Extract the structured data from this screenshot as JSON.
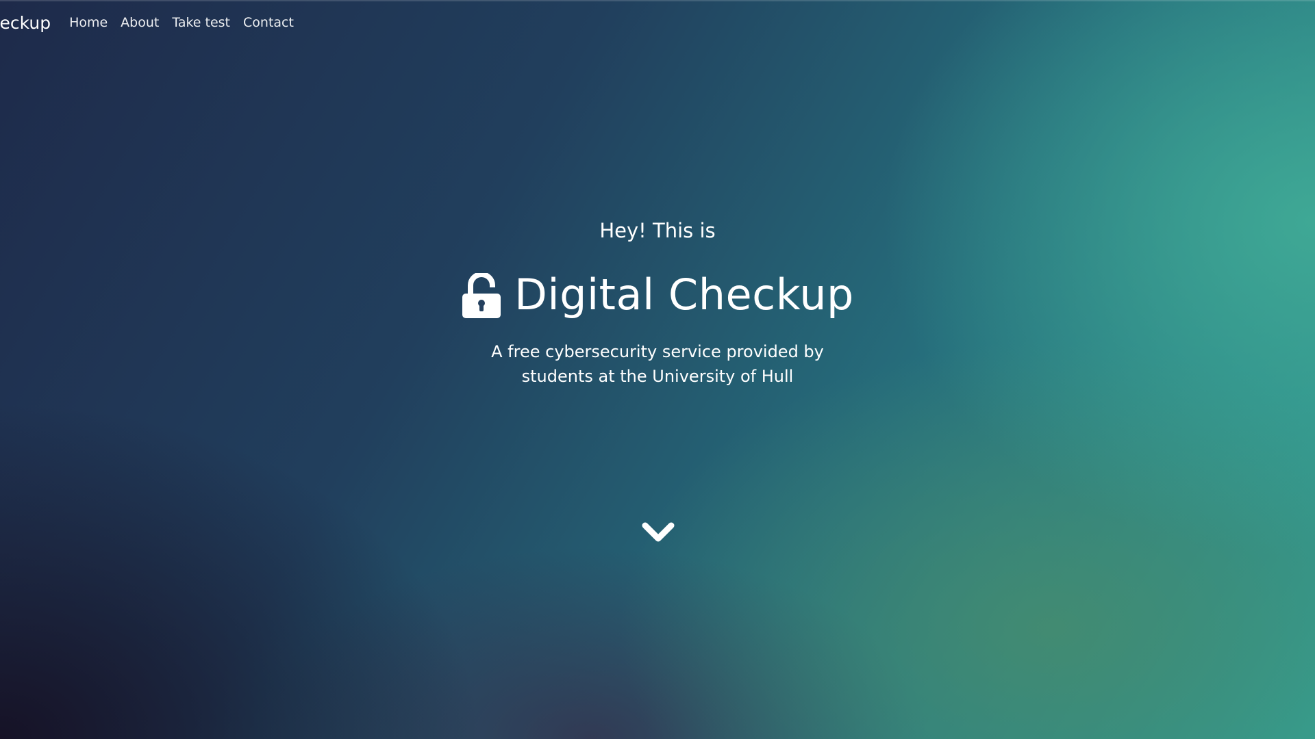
{
  "nav": {
    "brand": "al Checkup",
    "links": [
      "Home",
      "About",
      "Take test",
      "Contact"
    ]
  },
  "hero": {
    "intro": "Hey! This is",
    "title": "Digital Checkup",
    "subtitle_line1": "A free cybersecurity service provided by",
    "subtitle_line2": "students at the University of Hull",
    "title_icon": "unlocked-padlock-icon",
    "scroll_icon": "chevron-down-icon"
  },
  "colors": {
    "text": "#ffffff",
    "bg_dark": "#1e2a4a",
    "bg_teal": "#33a094"
  }
}
